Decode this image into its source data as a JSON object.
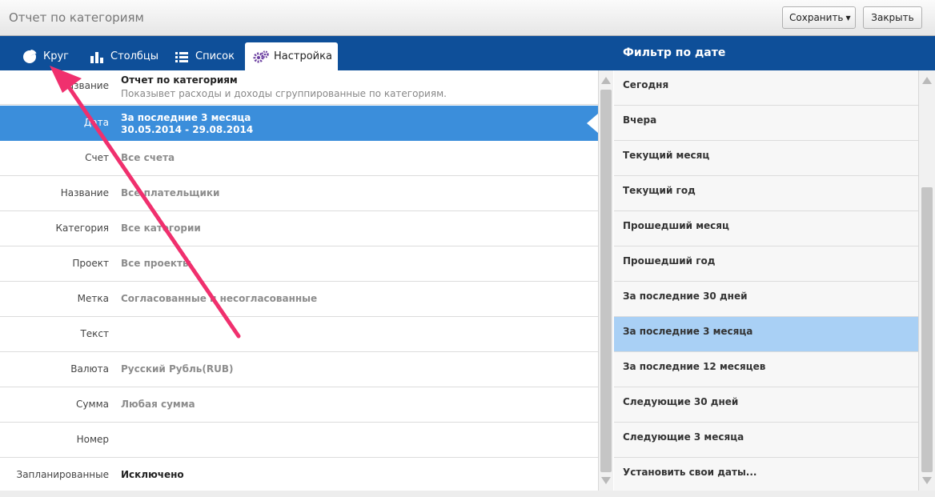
{
  "window": {
    "title": "Отчет по категориям",
    "save_label": "Сохранить",
    "close_label": "Закрыть"
  },
  "tabs": [
    {
      "label": "Круг",
      "icon": "pie-chart-icon"
    },
    {
      "label": "Столбцы",
      "icon": "bar-chart-icon"
    },
    {
      "label": "Список",
      "icon": "list-icon"
    },
    {
      "label": "Настройка",
      "icon": "settings-icon",
      "active": true
    }
  ],
  "settings": {
    "name_label": "Название",
    "name_value": "Отчет по категориям",
    "name_desc": "Показывет расходы и доходы сгруппированные по категориям.",
    "date_label": "Дата",
    "date_value": "За последние 3 месяца",
    "date_range": "30.05.2014 - 29.08.2014",
    "rows": [
      {
        "label": "Счет",
        "value": "Все счета"
      },
      {
        "label": "Название",
        "value": "Все плательщики"
      },
      {
        "label": "Категория",
        "value": "Все категории"
      },
      {
        "label": "Проект",
        "value": "Все проекты"
      },
      {
        "label": "Метка",
        "value": "Согласованные и несогласованные"
      },
      {
        "label": "Текст",
        "value": ""
      },
      {
        "label": "Валюта",
        "value": "Русский Рубль(RUB)"
      },
      {
        "label": "Сумма",
        "value": "Любая сумма"
      },
      {
        "label": "Номер",
        "value": ""
      },
      {
        "label": "Запланированные",
        "value": "Исключено"
      }
    ]
  },
  "date_filter": {
    "title": "Фильтр по дате",
    "items": [
      "Сегодня",
      "Вчера",
      "Текущий месяц",
      "Текущий год",
      "Прошедший месяц",
      "Прошедший год",
      "За последние 30 дней",
      "За последние 3 месяца",
      "За последние 12 месяцев",
      "Следующие 30 дней",
      "Следующие 3 месяца",
      "Установить свои даты..."
    ],
    "selected_index": 7
  },
  "colors": {
    "header_blue": "#0e4f99",
    "selection_blue": "#3b8edb",
    "selected_item": "#a9d0f5",
    "annotation_arrow": "#f0306e"
  }
}
